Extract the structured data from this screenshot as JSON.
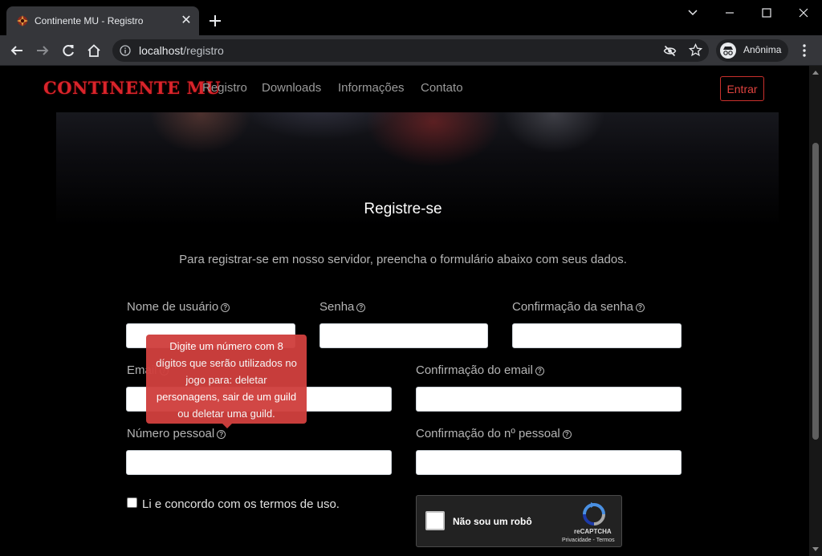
{
  "browser": {
    "tab_title": "Continente MU - Registro",
    "url_host": "localhost",
    "url_path": "/registro",
    "profile_label": "Anônima"
  },
  "site": {
    "logo": "CONTINENTE MU",
    "nav": [
      "Registro",
      "Downloads",
      "Informações",
      "Contato"
    ],
    "login_button": "Entrar"
  },
  "form": {
    "title": "Registre-se",
    "intro": "Para registrar-se em nosso servidor, preencha o formulário abaixo com seus dados.",
    "labels": {
      "username": "Nome de usuário",
      "password": "Senha",
      "password_confirm": "Confirmação da senha",
      "email": "Email",
      "email_confirm": "Confirmação do email",
      "personal_number": "Número pessoal",
      "personal_number_confirm": "Confirmação do nº pessoal"
    },
    "values": {
      "username": "",
      "password": "",
      "password_confirm": "",
      "email": "",
      "email_confirm": "",
      "personal_number": "",
      "personal_number_confirm": ""
    },
    "tooltip": "Digite um número com 8 dígitos que serão utilizados no jogo para: deletar personagens, sair de um guild ou deletar uma guild.",
    "terms_label": "Li e concordo com os termos de uso.",
    "terms_checked": false
  },
  "recaptcha": {
    "label": "Não sou um robô",
    "brand": "reCAPTCHA",
    "privacy": "Privacidade",
    "separator": "-",
    "terms": "Termos",
    "checked": false
  },
  "colors": {
    "accent_red": "#d9242b",
    "tooltip_bg": "#d0403e",
    "chrome_toolbar": "#35363a"
  },
  "icons": {
    "info": "info-icon",
    "help": "question-circle-icon"
  }
}
